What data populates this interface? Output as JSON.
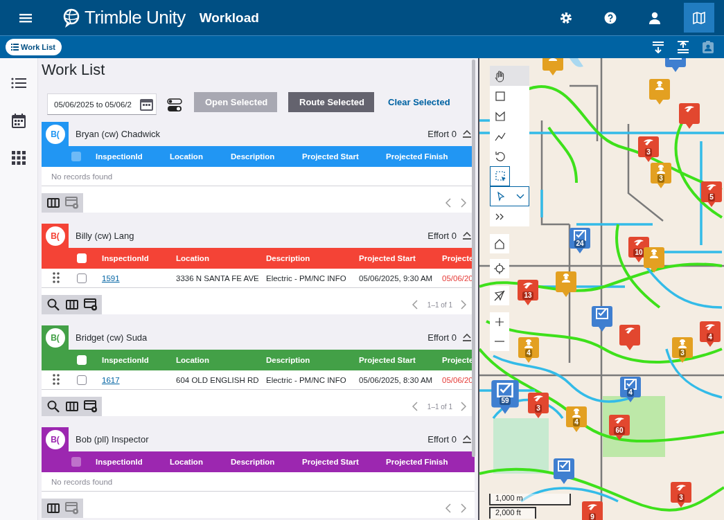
{
  "app_bar": {
    "logo_text": "Trimble Unity",
    "title": "Workload",
    "actions": [
      {
        "kind": "settings",
        "selected": false
      },
      {
        "kind": "help",
        "selected": false
      },
      {
        "kind": "user",
        "selected": false
      },
      {
        "kind": "map",
        "selected": true
      }
    ]
  },
  "sub_bar": {
    "work_list_button": "Work List",
    "actions": [
      {
        "kind": "collapse-all",
        "disabled": false
      },
      {
        "kind": "expand-all",
        "disabled": false
      },
      {
        "kind": "contact",
        "disabled": true
      }
    ]
  },
  "rail": [
    {
      "kind": "list"
    },
    {
      "kind": "calendar"
    },
    {
      "kind": "apps"
    }
  ],
  "work_list": {
    "title": "Work List",
    "date_range": "05/06/2025 to 05/06/2",
    "buttons": [
      {
        "label": "Open Selected",
        "kind": "secondary",
        "disabled": true
      },
      {
        "label": "Route Selected",
        "kind": "primary",
        "disabled": false
      },
      {
        "label": "Clear Selected",
        "kind": "link",
        "disabled": false
      }
    ],
    "sections": [
      {
        "initials": "B(",
        "assignee": "Bryan (cw) Chadwick",
        "color": "#2196f3",
        "effort": "Effort 0",
        "columns": [
          "InspectionId",
          "Location",
          "Description",
          "Projected Start",
          "Projected Finish"
        ],
        "select_all": {
          "checked": false,
          "disabled": true
        },
        "empty_message": "No records found",
        "tools": [
          {
            "kind": "columns",
            "disabled": false
          },
          {
            "kind": "table-settings",
            "disabled": true
          }
        ]
      },
      {
        "initials": "B(",
        "assignee": "Billy (cw) Lang",
        "color": "#f44336",
        "effort": "Effort 0",
        "columns": [
          "InspectionId",
          "Location",
          "Description",
          "Projected Start",
          "Projecte"
        ],
        "select_all": {
          "checked": false,
          "disabled": false
        },
        "rows": [
          {
            "checked": false,
            "id": "1591",
            "location": "3336 N SANTA FE AVE",
            "description": "Electric - PM/NC INFO",
            "start": "05/06/2025, 9:30 AM",
            "finish": "05/06/20",
            "overdue": true
          }
        ],
        "pagination": "1–1 of 1",
        "tools": [
          {
            "kind": "search",
            "disabled": false
          },
          {
            "kind": "columns",
            "disabled": false
          },
          {
            "kind": "table-settings",
            "disabled": false
          }
        ]
      },
      {
        "initials": "B(",
        "assignee": "Bridget (cw) Suda",
        "color": "#43a047",
        "effort": "Effort 0",
        "columns": [
          "InspectionId",
          "Location",
          "Description",
          "Projected Start",
          "Projecte"
        ],
        "select_all": {
          "checked": false,
          "disabled": false
        },
        "rows": [
          {
            "checked": false,
            "id": "1617",
            "location": "604 OLD ENGLISH RD",
            "description": "Electric - PM/NC INFO",
            "start": "05/06/2025, 8:30 AM",
            "finish": "05/06/20",
            "overdue": true
          }
        ],
        "pagination": "1–1 of 1",
        "tools": [
          {
            "kind": "search",
            "disabled": false
          },
          {
            "kind": "columns",
            "disabled": false
          },
          {
            "kind": "table-settings",
            "disabled": false
          }
        ]
      },
      {
        "initials": "B(",
        "assignee": "Bob (pll) Inspector",
        "color": "#9c27b0",
        "effort": "Effort 0",
        "columns": [
          "InspectionId",
          "Location",
          "Description",
          "Projected Start",
          "Projected Finish"
        ],
        "select_all": {
          "checked": false,
          "disabled": true
        },
        "empty_message": "No records found",
        "tools": [
          {
            "kind": "columns",
            "disabled": false
          },
          {
            "kind": "table-settings",
            "disabled": true
          }
        ]
      }
    ]
  },
  "map": {
    "kind": "picture",
    "tools": [
      {
        "kind": "pan",
        "selected": false,
        "hovered": true
      },
      {
        "kind": "rectangle",
        "selected": false,
        "hovered": false
      },
      {
        "kind": "polygon",
        "selected": false,
        "hovered": false
      },
      {
        "kind": "polyline",
        "selected": false,
        "hovered": false
      },
      {
        "kind": "undo",
        "selected": false,
        "hovered": false
      },
      {
        "kind": "select-box",
        "selected": true,
        "hovered": false
      },
      {
        "kind": "select-pointer",
        "selected": false,
        "hovered": false
      },
      {
        "kind": "expand",
        "selected": false,
        "hovered": false
      }
    ],
    "controls": [
      {
        "kind": "home"
      },
      {
        "kind": "locate"
      },
      {
        "kind": "gps-off"
      },
      {
        "kind": "zoom-in"
      },
      {
        "kind": "zoom-out"
      }
    ],
    "markers": [
      {
        "kind": "worker"
      },
      {
        "kind": "task"
      },
      {
        "kind": "worker"
      },
      {
        "kind": "hammer"
      },
      {
        "kind": "hammer",
        "count": "3"
      },
      {
        "kind": "worker",
        "count": "3"
      },
      {
        "kind": "hammer",
        "count": "5"
      },
      {
        "kind": "task",
        "count": "24"
      },
      {
        "kind": "hammer",
        "count": "10"
      },
      {
        "kind": "worker"
      },
      {
        "kind": "hammer",
        "count": "13"
      },
      {
        "kind": "worker"
      },
      {
        "kind": "task"
      },
      {
        "kind": "hammer"
      },
      {
        "kind": "hammer",
        "count": "4"
      },
      {
        "kind": "worker",
        "count": "4"
      },
      {
        "kind": "worker",
        "count": "3"
      },
      {
        "kind": "task",
        "count": "59"
      },
      {
        "kind": "hammer",
        "count": "3"
      },
      {
        "kind": "worker",
        "count": "4"
      },
      {
        "kind": "task",
        "count": "4"
      },
      {
        "kind": "hammer",
        "count": "60"
      },
      {
        "kind": "task"
      },
      {
        "kind": "hammer",
        "count": "3"
      },
      {
        "kind": "hammer",
        "count": "9"
      }
    ],
    "scale_bar": [
      "1,000 m",
      "2,000 ft"
    ]
  }
}
